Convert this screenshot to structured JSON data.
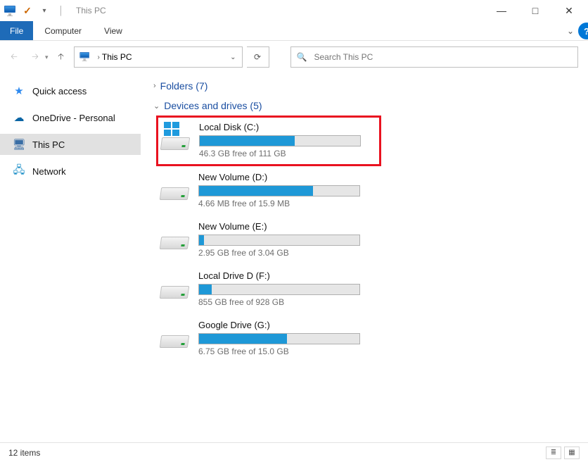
{
  "window": {
    "title": "This PC",
    "controls": {
      "minimize": "—",
      "maximize": "□",
      "close": "✕"
    }
  },
  "ribbon": {
    "file_tab": "File",
    "tabs": [
      "Computer",
      "View"
    ]
  },
  "nav": {
    "location": "This PC",
    "search_placeholder": "Search This PC"
  },
  "sidebar": {
    "items": [
      {
        "label": "Quick access"
      },
      {
        "label": "OneDrive - Personal"
      },
      {
        "label": "This PC"
      },
      {
        "label": "Network"
      }
    ]
  },
  "groups": {
    "folders": {
      "label": "Folders",
      "count": 7
    },
    "drives": {
      "label": "Devices and drives",
      "count": 5
    }
  },
  "drives": [
    {
      "name": "Local Disk (C:)",
      "free_text": "46.3 GB free of 111 GB",
      "used_pct": 59,
      "highlighted": true,
      "os": true
    },
    {
      "name": "New Volume (D:)",
      "free_text": "4.66 MB free of 15.9 MB",
      "used_pct": 71,
      "highlighted": false,
      "os": false
    },
    {
      "name": "New Volume (E:)",
      "free_text": "2.95 GB free of 3.04 GB",
      "used_pct": 3,
      "highlighted": false,
      "os": false
    },
    {
      "name": "Local Drive D (F:)",
      "free_text": "855 GB free of 928 GB",
      "used_pct": 8,
      "highlighted": false,
      "os": false
    },
    {
      "name": "Google Drive (G:)",
      "free_text": "6.75 GB free of 15.0 GB",
      "used_pct": 55,
      "highlighted": false,
      "os": false
    }
  ],
  "status": {
    "items_text": "12 items"
  },
  "colors": {
    "accent": "#1e98d7",
    "link": "#1a4ea1",
    "highlight": "#e91220"
  }
}
